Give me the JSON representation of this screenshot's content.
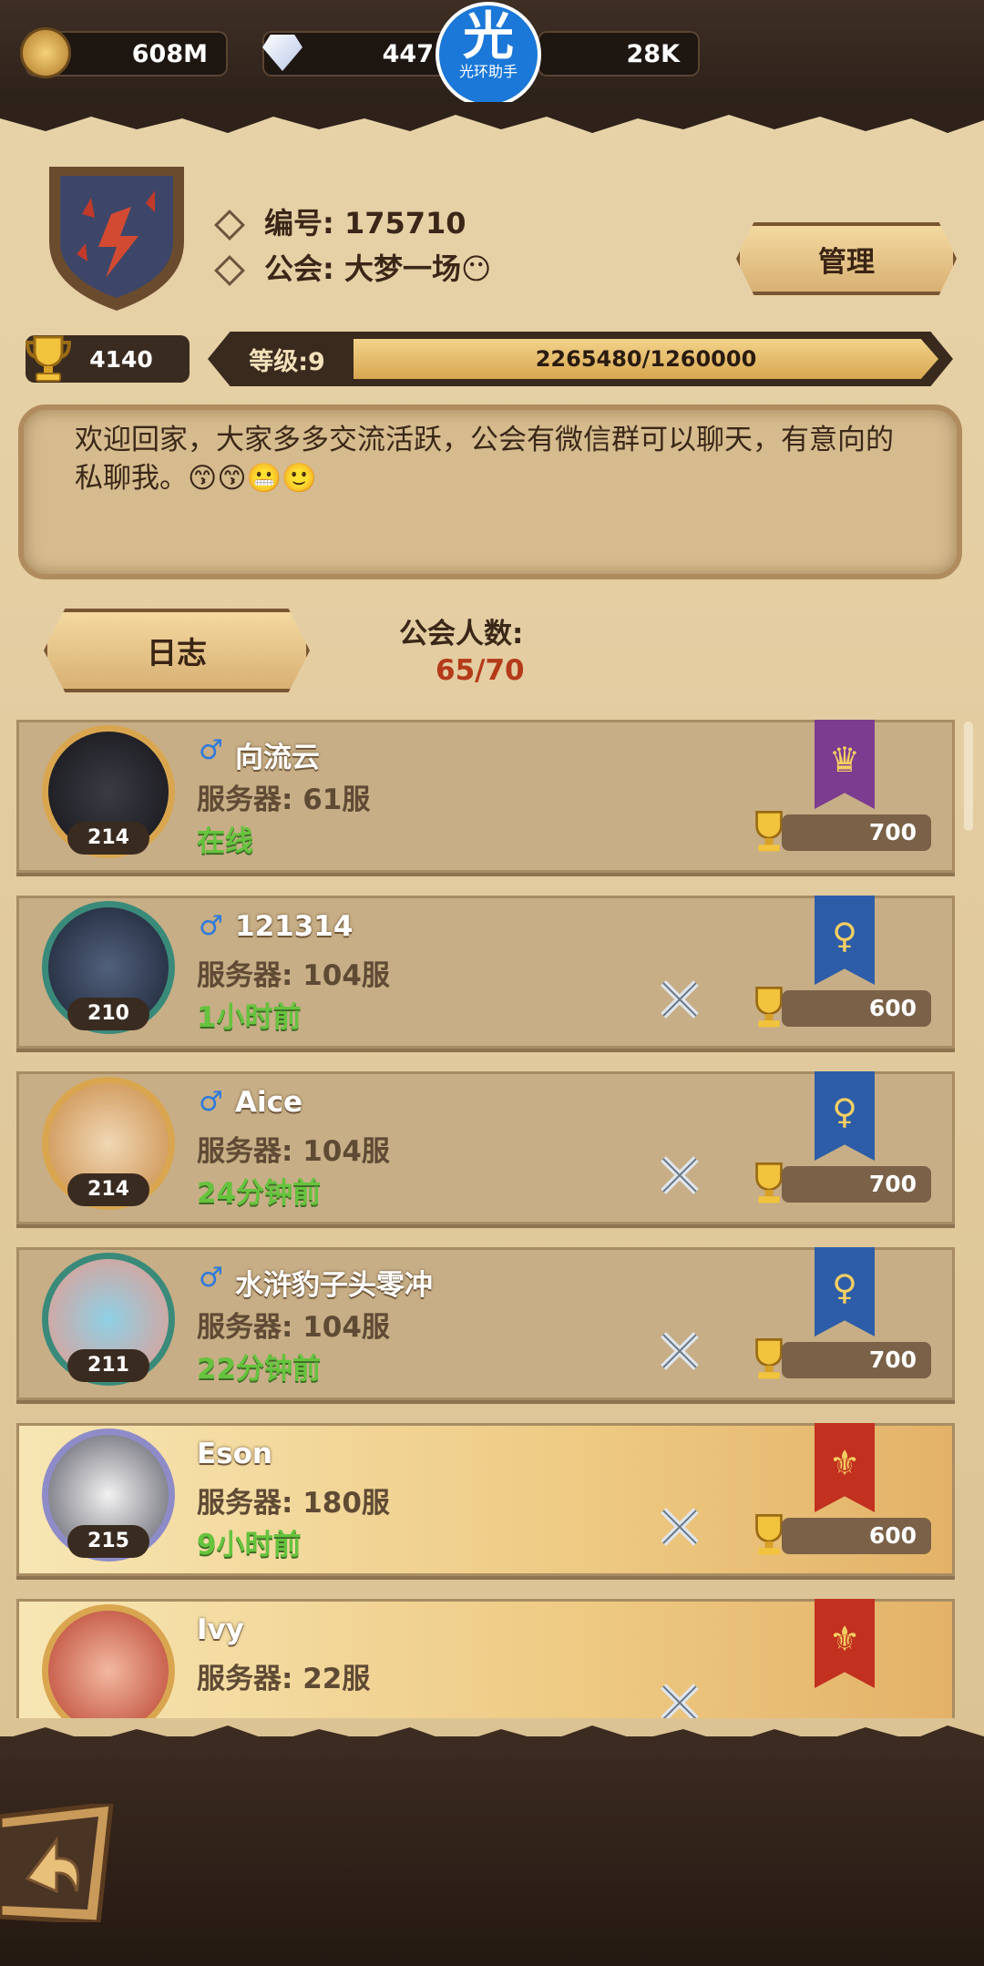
{
  "resources": {
    "gold": "608M",
    "diamonds": "447",
    "third": "28K"
  },
  "watermark": {
    "big": "光",
    "small": "光环助手"
  },
  "guild": {
    "id_label": "编号: 175710",
    "name_label": "公会: 大梦一场😶",
    "manage_button": "管理",
    "trophies": "4140",
    "level_label": "等级:9",
    "level_progress": "2265480/1260000",
    "level_fill": 1.0,
    "notice": "欢迎回家，大家多多交流活跃，公会有微信群可以聊天，有意向的私聊我。😙😙😬🙂",
    "log_button": "日志",
    "member_label": "公会人数:",
    "member_count": "65/70"
  },
  "members": [
    {
      "name": "向流云",
      "server": "服务器: 61服",
      "status": "在线",
      "level": "214",
      "score": "700",
      "banner": "purple",
      "gender": true,
      "swords": false,
      "gold": false
    },
    {
      "name": "121314",
      "server": "服务器: 104服",
      "status": "1小时前",
      "level": "210",
      "score": "600",
      "banner": "blue",
      "gender": true,
      "swords": true,
      "gold": false
    },
    {
      "name": "Aice",
      "server": "服务器: 104服",
      "status": "24分钟前",
      "level": "214",
      "score": "700",
      "banner": "blue",
      "gender": true,
      "swords": true,
      "gold": false
    },
    {
      "name": "水浒豹子头零冲",
      "server": "服务器: 104服",
      "status": "22分钟前",
      "level": "211",
      "score": "700",
      "banner": "blue",
      "gender": true,
      "swords": true,
      "gold": false
    },
    {
      "name": "Eson",
      "server": "服务器: 180服",
      "status": "9小时前",
      "level": "215",
      "score": "600",
      "banner": "red",
      "gender": false,
      "swords": true,
      "gold": true
    },
    {
      "name": "Ivy",
      "server": "服务器: 22服",
      "status": "",
      "level": "",
      "score": "",
      "banner": "red",
      "gender": false,
      "swords": true,
      "gold": true
    }
  ],
  "colors": {
    "online": "#66c33e",
    "count": "#b43a1a",
    "banner_purple": "#7c3c8f",
    "banner_blue": "#2d5da8",
    "banner_red": "#c2301f"
  }
}
